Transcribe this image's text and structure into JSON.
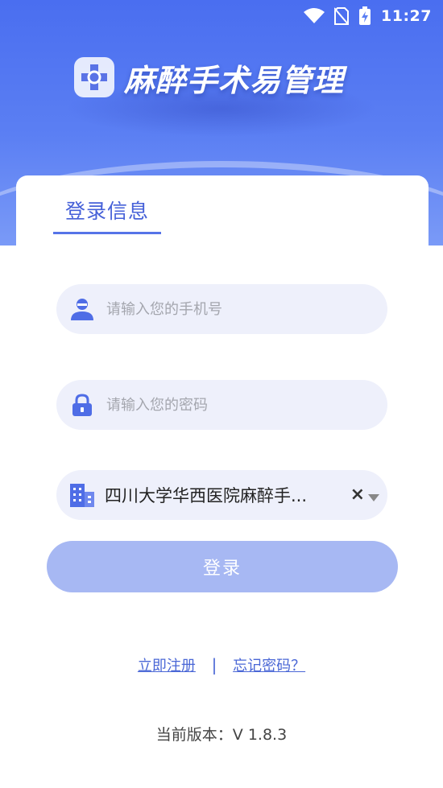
{
  "status_bar": {
    "time": "11:27",
    "icons": [
      "wifi-icon",
      "no-sim-icon",
      "battery-charging-icon"
    ]
  },
  "header": {
    "app_title": "麻醉手术易管理",
    "logo_icon": "hospital-cross-icon"
  },
  "login": {
    "tab_label": "登录信息",
    "phone_placeholder": "请输入您的手机号",
    "password_placeholder": "请输入您的密码",
    "organization_value": "四川大学华西医院麻醉手...",
    "clear_symbol": "×",
    "login_button_label": "登录"
  },
  "links": {
    "register": "立即注册",
    "separator": "|",
    "forgot_password": "忘记密码？"
  },
  "footer": {
    "version_text": "当前版本：V 1.8.3"
  },
  "colors": {
    "primary": "#5674e8",
    "button_disabled": "#a7b8f3",
    "field_bg": "#eef0fb"
  }
}
